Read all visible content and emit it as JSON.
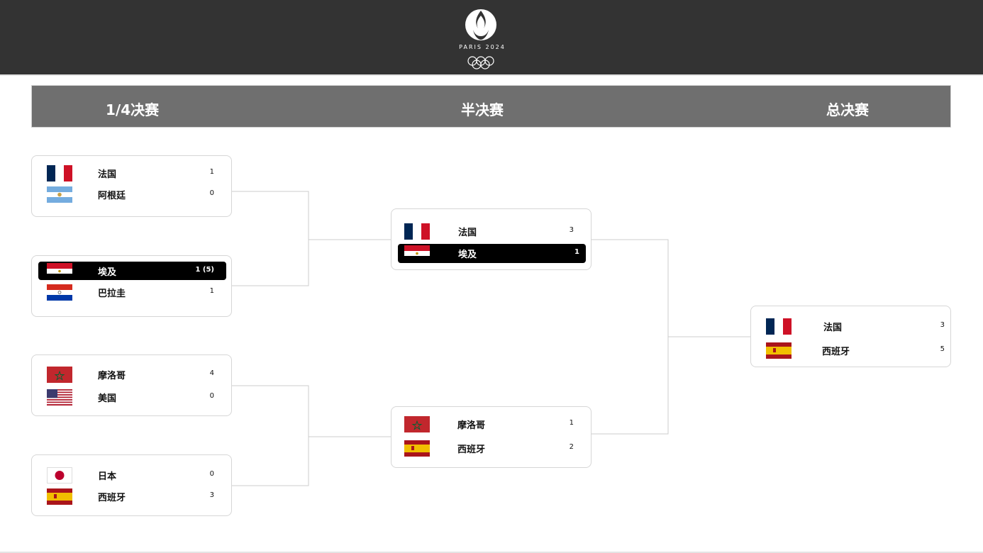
{
  "header": {
    "logo_text": "PARIS 2024",
    "bg_color": "#333333"
  },
  "stages": {
    "quarter": "1/4决赛",
    "semi": "半决赛",
    "final": "总决赛"
  },
  "colors": {
    "highlight": "#000000",
    "stage_bar": "#6f6f6f",
    "connector": "#cccccc"
  },
  "quarterfinals": [
    {
      "teams": [
        {
          "name": "法国",
          "score": "1",
          "flag": "france-flag"
        },
        {
          "name": "阿根廷",
          "score": "0",
          "flag": "argentina-flag"
        }
      ]
    },
    {
      "teams": [
        {
          "name": "埃及",
          "score": "1 (5)",
          "flag": "egypt-flag",
          "highlight": true
        },
        {
          "name": "巴拉圭",
          "score": "1",
          "flag": "paraguay-flag"
        }
      ]
    },
    {
      "teams": [
        {
          "name": "摩洛哥",
          "score": "4",
          "flag": "morocco-flag"
        },
        {
          "name": "美国",
          "score": "0",
          "flag": "usa-flag"
        }
      ]
    },
    {
      "teams": [
        {
          "name": "日本",
          "score": "0",
          "flag": "japan-flag"
        },
        {
          "name": "西班牙",
          "score": "3",
          "flag": "spain-flag"
        }
      ]
    }
  ],
  "semifinals": [
    {
      "teams": [
        {
          "name": "法国",
          "score": "3",
          "flag": "france-flag"
        },
        {
          "name": "埃及",
          "score": "1",
          "flag": "egypt-flag",
          "highlight": true
        }
      ]
    },
    {
      "teams": [
        {
          "name": "摩洛哥",
          "score": "1",
          "flag": "morocco-flag"
        },
        {
          "name": "西班牙",
          "score": "2",
          "flag": "spain-flag"
        }
      ]
    }
  ],
  "final": {
    "teams": [
      {
        "name": "法国",
        "score": "3",
        "flag": "france-flag"
      },
      {
        "name": "西班牙",
        "score": "5",
        "flag": "spain-flag"
      }
    ]
  }
}
